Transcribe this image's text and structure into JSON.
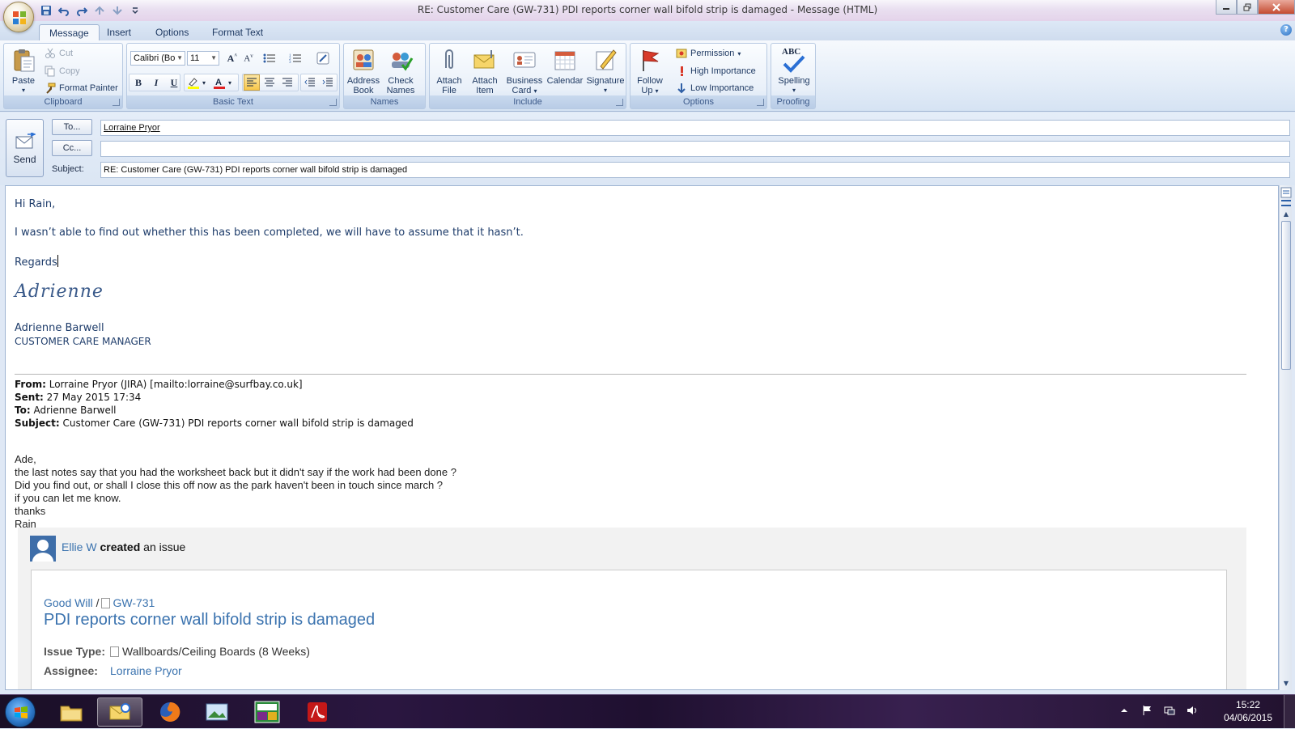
{
  "window": {
    "title": "RE: Customer Care (GW-731) PDI reports corner wall bifold strip is damaged - Message (HTML)"
  },
  "tabs": [
    {
      "label": "Message",
      "active": true
    },
    {
      "label": "Insert",
      "active": false
    },
    {
      "label": "Options",
      "active": false
    },
    {
      "label": "Format Text",
      "active": false
    }
  ],
  "ribbon": {
    "clipboard": {
      "label": "Clipboard",
      "paste": "Paste",
      "cut": "Cut",
      "copy": "Copy",
      "format_painter": "Format Painter"
    },
    "basic_text": {
      "label": "Basic Text",
      "font_name": "Calibri (Bo",
      "font_size": "11",
      "bold": "B",
      "italic": "I",
      "underline": "U"
    },
    "names": {
      "label": "Names",
      "address_book_1": "Address",
      "address_book_2": "Book",
      "check_names_1": "Check",
      "check_names_2": "Names"
    },
    "include": {
      "label": "Include",
      "attach_file_1": "Attach",
      "attach_file_2": "File",
      "attach_item_1": "Attach",
      "attach_item_2": "Item",
      "business_card_1": "Business",
      "business_card_2": "Card",
      "calendar": "Calendar",
      "signature": "Signature"
    },
    "options": {
      "label": "Options",
      "follow_up_1": "Follow",
      "follow_up_2": "Up",
      "permission": "Permission",
      "high_importance": "High Importance",
      "low_importance": "Low Importance"
    },
    "proofing": {
      "label": "Proofing",
      "spelling": "Spelling",
      "abc": "ABC"
    }
  },
  "header": {
    "send": "Send",
    "to_button": "To...",
    "cc_button": "Cc...",
    "subject_label": "Subject:",
    "to_value": "Lorraine Pryor",
    "cc_value": "",
    "subject_value": "RE: Customer Care (GW-731) PDI reports corner wall bifold strip is damaged"
  },
  "body": {
    "greeting": "Hi Rain,",
    "line1": "I wasn’t able to find out whether this has been completed, we will have to assume that it hasn’t.",
    "regards": "Regards",
    "signature_script": "Adrienne",
    "sig_name": "Adrienne Barwell",
    "sig_title": "CUSTOMER CARE MANAGER",
    "quoted_header": {
      "from_label": "From:",
      "from_value": " Lorraine Pryor (JIRA) [mailto:lorraine@surfbay.co.uk]",
      "sent_label": "Sent:",
      "sent_value": " 27 May 2015 17:34",
      "to_label": "To:",
      "to_value": " Adrienne Barwell",
      "subject_label": "Subject:",
      "subject_value": " Customer Care (GW-731) PDI reports corner wall bifold strip is damaged"
    },
    "quoted_lines": [
      "Ade,",
      "the last notes say that you had the worksheet back but it didn't say if the work had been done ?",
      "Did you find out, or shall I close this off now as the park haven't been in touch since march ?",
      "if you can let me know.",
      "thanks",
      "Rain"
    ],
    "jira": {
      "user": "Ellie W",
      "action": "created",
      "action_rest": " an issue",
      "project": "Good Will",
      "slash": " /",
      "issue_key": "GW-731",
      "title": "PDI reports corner wall bifold strip is damaged",
      "issue_type_label": "Issue Type:",
      "issue_type_value": "Wallboards/Ceiling Boards (8 Weeks)",
      "assignee_label": "Assignee:",
      "assignee_value": "Lorraine Pryor"
    }
  },
  "taskbar": {
    "time": "15:22",
    "date": "04/06/2015"
  },
  "colors": {
    "ribbon_blue": "#d6e3f3",
    "body_text": "#1f3d6b",
    "jira_link": "#3b73af"
  }
}
